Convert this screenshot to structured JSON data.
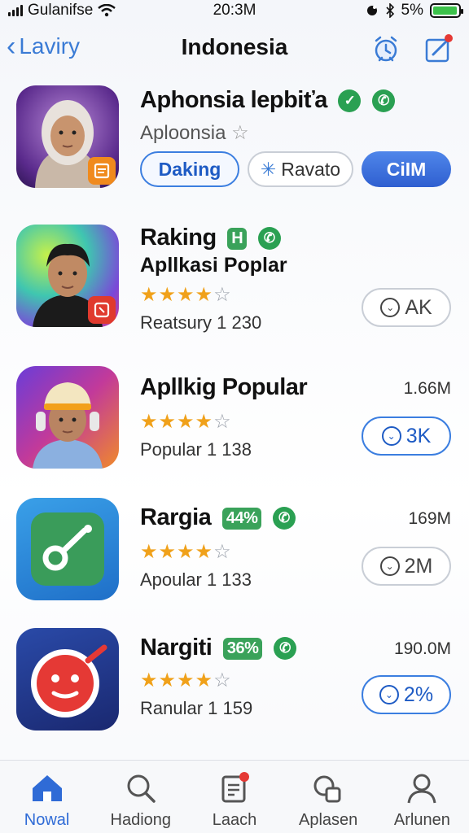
{
  "status_bar": {
    "carrier": "Gulanifse",
    "time": "20:3M",
    "battery": "5%",
    "battery_level": 0.95
  },
  "nav": {
    "back_label": "Laviry",
    "title": "Indonesia",
    "icons": [
      "alarm-icon",
      "compose-icon"
    ]
  },
  "featured": {
    "title": "Aphonsia lepbiťa",
    "subtitle": "Aploonsia",
    "buttons": {
      "daking": "Daking",
      "ravato": "Ravato",
      "cim": "CiIM"
    }
  },
  "apps": [
    {
      "title": "Raking",
      "chip": "H",
      "subtitle": "Apllkasi Poplar",
      "rating": 4,
      "meta": "Reatsury 1 230",
      "size": "",
      "button_label": "AK"
    },
    {
      "title": "Apllkig Popular",
      "chip": "",
      "subtitle": "",
      "rating": 4,
      "meta": "Popular  1 138",
      "size": "1.66M",
      "button_label": "3K"
    },
    {
      "title": "Rargia",
      "chip": "44%",
      "subtitle": "",
      "rating": 4,
      "meta": "Apoular  1 133",
      "size": "169M",
      "button_label": "2M"
    },
    {
      "title": "Nargiti",
      "chip": "36%",
      "subtitle": "",
      "rating": 4,
      "meta": "Ranular  1 159",
      "size": "190.0M",
      "button_label": "2%"
    }
  ],
  "tabs": [
    {
      "label": "Nowal",
      "icon": "home-icon",
      "active": true
    },
    {
      "label": "Hadiong",
      "icon": "search-icon",
      "active": false
    },
    {
      "label": "Laach",
      "icon": "document-icon",
      "active": false
    },
    {
      "label": "Aplasen",
      "icon": "apps-icon",
      "active": false
    },
    {
      "label": "Arlunen",
      "icon": "person-icon",
      "active": false
    }
  ],
  "colors": {
    "accent": "#3a7bd5",
    "star": "#f0a11a",
    "chip_green": "#3aa25a"
  }
}
